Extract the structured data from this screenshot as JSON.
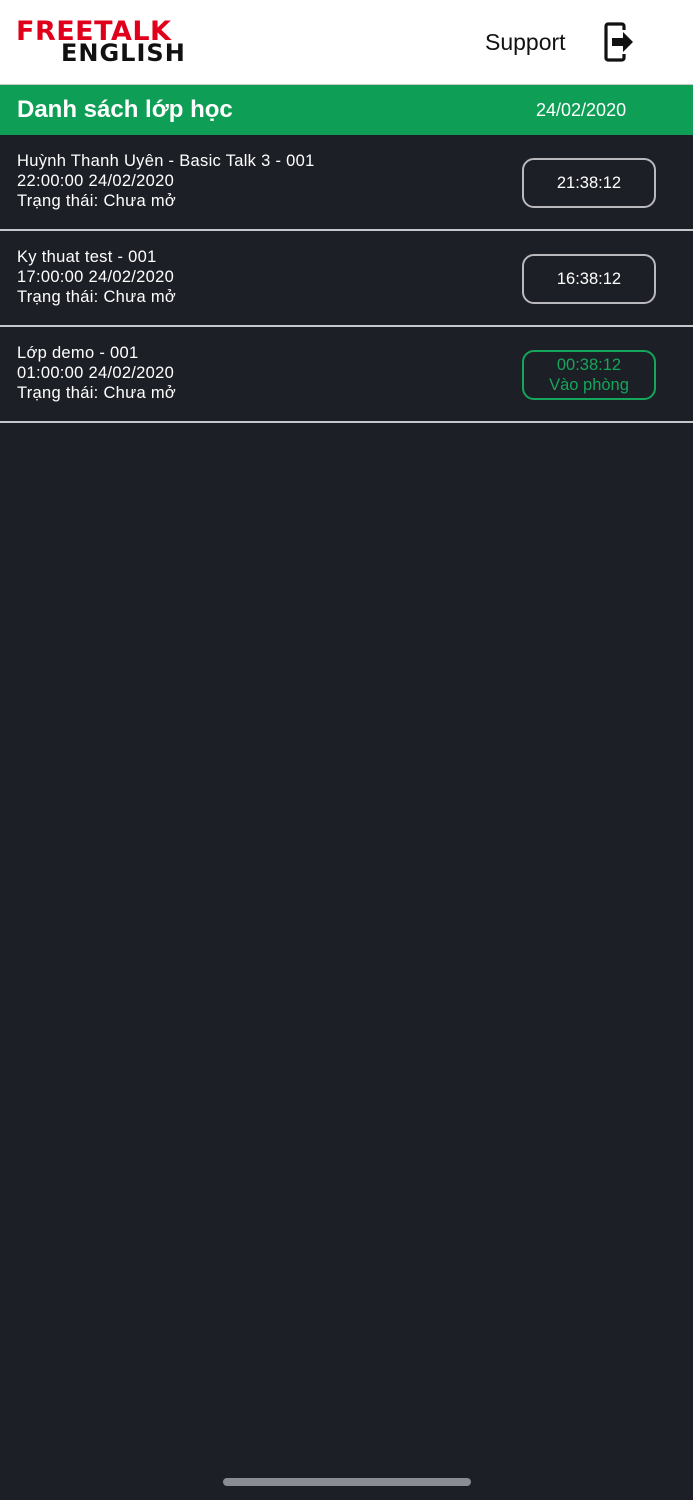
{
  "header": {
    "logo_line1": "FREETALK",
    "logo_line2": "ENGLISH",
    "support_label": "Support",
    "logout_icon": "logout-icon",
    "brand_red": "#e0001b"
  },
  "titlebar": {
    "title": "Danh sách lớp học",
    "date": "24/02/2020",
    "color": "#0e9e55"
  },
  "classes": [
    {
      "name": "Huỳnh Thanh Uyên - Basic Talk 3 - 001",
      "time": "22:00:00 24/02/2020",
      "status": "Trạng thái: Chưa mở",
      "countdown": "21:38:12"
    },
    {
      "name": "Ky thuat test - 001",
      "time": "17:00:00 24/02/2020",
      "status": "Trạng thái: Chưa mở",
      "countdown": "16:38:12"
    },
    {
      "name": "Lớp demo - 001",
      "time": "01:00:00 24/02/2020",
      "status": "Trạng thái: Chưa mở",
      "countdown": "00:38:12",
      "action": "Vào phòng"
    }
  ]
}
